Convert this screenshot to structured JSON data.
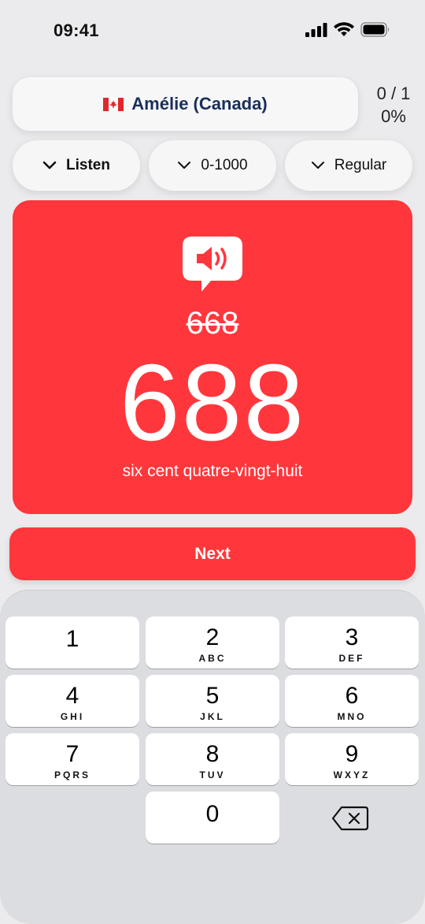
{
  "status_bar": {
    "time": "09:41"
  },
  "voice": {
    "flag_icon": "canada-flag-icon",
    "name": "Amélie (Canada)"
  },
  "score": {
    "count": "0 / 1",
    "percent": "0%"
  },
  "dropdowns": [
    {
      "label": "Listen",
      "icon": "chevron-down-icon"
    },
    {
      "label": "0-1000",
      "icon": "chevron-down-icon"
    },
    {
      "label": "Regular",
      "icon": "chevron-down-icon"
    }
  ],
  "card": {
    "color": "#ff373c",
    "speaker_icon": "speaker-bubble-icon",
    "wrong_answer": "668",
    "correct_answer": "688",
    "correct_words": "six cent quatre-vingt-huit"
  },
  "next_button": {
    "label": "Next"
  },
  "keypad": {
    "keys": [
      {
        "digit": "1",
        "letters": ""
      },
      {
        "digit": "2",
        "letters": "ABC"
      },
      {
        "digit": "3",
        "letters": "DEF"
      },
      {
        "digit": "4",
        "letters": "GHI"
      },
      {
        "digit": "5",
        "letters": "JKL"
      },
      {
        "digit": "6",
        "letters": "MNO"
      },
      {
        "digit": "7",
        "letters": "PQRS"
      },
      {
        "digit": "8",
        "letters": "TUV"
      },
      {
        "digit": "9",
        "letters": "WXYZ"
      },
      {
        "digit": "0",
        "letters": ""
      }
    ],
    "backspace_icon": "backspace-icon"
  }
}
